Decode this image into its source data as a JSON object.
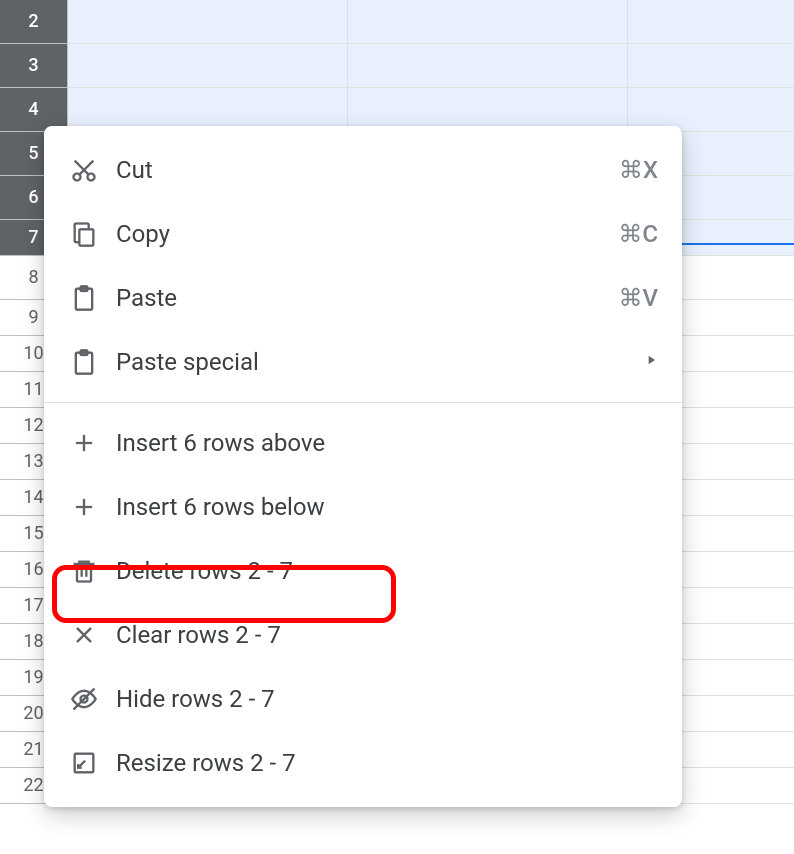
{
  "row_headers": [
    {
      "num": "2",
      "selected": true,
      "narrow": false
    },
    {
      "num": "3",
      "selected": true,
      "narrow": false
    },
    {
      "num": "4",
      "selected": true,
      "narrow": false
    },
    {
      "num": "5",
      "selected": true,
      "narrow": false
    },
    {
      "num": "6",
      "selected": true,
      "narrow": false
    },
    {
      "num": "7",
      "selected": true,
      "narrow": true
    },
    {
      "num": "8",
      "selected": false,
      "narrow": false
    },
    {
      "num": "9",
      "selected": false,
      "narrow": true
    },
    {
      "num": "10",
      "selected": false,
      "narrow": true
    },
    {
      "num": "11",
      "selected": false,
      "narrow": true
    },
    {
      "num": "12",
      "selected": false,
      "narrow": true
    },
    {
      "num": "13",
      "selected": false,
      "narrow": true
    },
    {
      "num": "14",
      "selected": false,
      "narrow": true
    },
    {
      "num": "15",
      "selected": false,
      "narrow": true
    },
    {
      "num": "16",
      "selected": false,
      "narrow": true
    },
    {
      "num": "17",
      "selected": false,
      "narrow": true
    },
    {
      "num": "18",
      "selected": false,
      "narrow": true
    },
    {
      "num": "19",
      "selected": false,
      "narrow": true
    },
    {
      "num": "20",
      "selected": false,
      "narrow": true
    },
    {
      "num": "21",
      "selected": false,
      "narrow": true
    },
    {
      "num": "22",
      "selected": false,
      "narrow": true
    }
  ],
  "menu": {
    "cut": {
      "label": "Cut",
      "shortcut": "⌘X"
    },
    "copy": {
      "label": "Copy",
      "shortcut": "⌘C"
    },
    "paste": {
      "label": "Paste",
      "shortcut": "⌘V"
    },
    "paste_special": {
      "label": "Paste special"
    },
    "insert_above": {
      "label": "Insert 6 rows above"
    },
    "insert_below": {
      "label": "Insert 6 rows below"
    },
    "delete_rows": {
      "label": "Delete rows 2 - 7"
    },
    "clear_rows": {
      "label": "Clear rows 2 - 7"
    },
    "hide_rows": {
      "label": "Hide rows 2 - 7"
    },
    "resize_rows": {
      "label": "Resize rows 2 - 7"
    }
  }
}
